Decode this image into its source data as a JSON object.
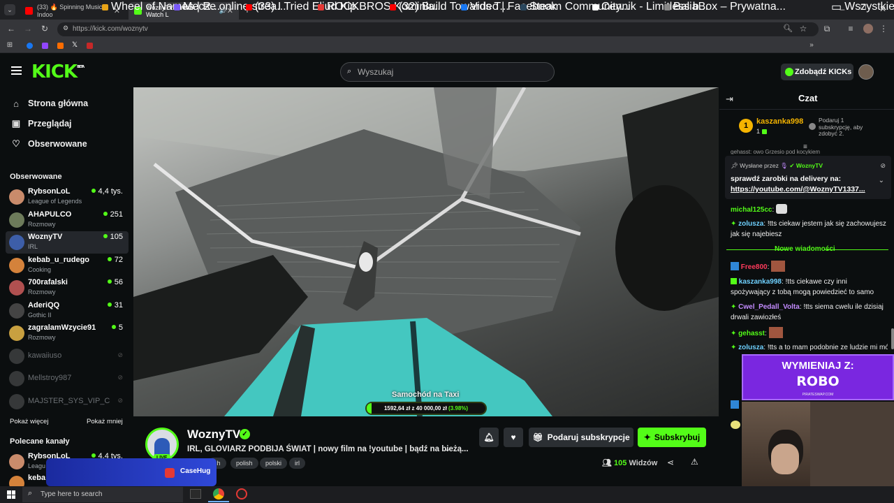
{
  "browser": {
    "tabs": [
      {
        "label": "(33) 🔥 Spinning Music – Indoo",
        "active": false,
        "color": "#ff0000"
      },
      {
        "label": "WoznyTV Stream - Watch L",
        "active": true,
        "color": "#53fc18"
      }
    ],
    "url": "https://kick.com/woznytv",
    "bookmarks": [
      {
        "label": "Wheel of Names | R...",
        "color": "#e8a317"
      },
      {
        "label": "Mecze online strea...",
        "color": "#7a5af8"
      },
      {
        "label": "(33) I Tried Eliud Kip...",
        "color": "#ff0000"
      },
      {
        "label": "ROCKBROS Kominia...",
        "color": "#e53935"
      },
      {
        "label": "(32) Build Towards T...",
        "color": "#ff0000"
      },
      {
        "label": "Video | Facebook",
        "color": "#1877f2"
      },
      {
        "label": "Steam Community...",
        "color": "#2a475e"
      },
      {
        "label": "Cennik - Limitless b...",
        "color": "#ffffff"
      },
      {
        "label": "BaliaBox – Prywatna...",
        "color": "#888888"
      }
    ],
    "all_bookmarks": "Wszystkie zakładki"
  },
  "header": {
    "logo": "KICK",
    "logo_sup": "BETA",
    "search_placeholder": "Wyszukaj",
    "kicks_button": "Zdobądź KICKs"
  },
  "sidebar": {
    "nav": [
      {
        "label": "Strona główna",
        "icon": "home-icon"
      },
      {
        "label": "Przeglądaj",
        "icon": "browse-icon"
      },
      {
        "label": "Obserwowane",
        "icon": "heart-icon"
      }
    ],
    "followed_title": "Obserwowane",
    "followed": [
      {
        "name": "RybsonLoL",
        "category": "League of Legends",
        "viewers": "4,4 tys.",
        "color": "#c98b6b",
        "live": true
      },
      {
        "name": "AHAPULCO",
        "category": "Rozmowy",
        "viewers": "251",
        "color": "#6d7b5a",
        "live": true
      },
      {
        "name": "WoznyTV",
        "category": "IRL",
        "viewers": "105",
        "color": "#3d5ea8",
        "live": true,
        "selected": true
      },
      {
        "name": "kebab_u_rudego",
        "category": "Cooking",
        "viewers": "72",
        "color": "#d4823b",
        "live": true
      },
      {
        "name": "700rafalski",
        "category": "Rozmowy",
        "viewers": "56",
        "color": "#b05050",
        "live": true
      },
      {
        "name": "AderiQQ",
        "category": "Gothic II",
        "viewers": "31",
        "color": "#444444",
        "live": true
      },
      {
        "name": "zagralamWzycie91",
        "category": "Rozmowy",
        "viewers": "5",
        "color": "#c8a040",
        "live": true
      },
      {
        "name": "kawaiiuso",
        "category": "",
        "viewers": "",
        "color": "#777777",
        "live": false
      },
      {
        "name": "Mellstroy987",
        "category": "",
        "viewers": "",
        "color": "#777777",
        "live": false
      },
      {
        "name": "MAJSTER_SYS_VIP_C",
        "category": "",
        "viewers": "",
        "color": "#777777",
        "live": false
      }
    ],
    "show_more": "Pokaż więcej",
    "show_less": "Pokaż mniej",
    "recommended_title": "Polecane kanały",
    "recommended": [
      {
        "name": "RybsonLoL",
        "category": "Leagu",
        "viewers": "4,4 tys.",
        "color": "#c98b6b"
      },
      {
        "name": "keba",
        "category": "",
        "viewers": "",
        "color": "#d4823b"
      }
    ]
  },
  "video": {
    "caption": "Samochód na Taxi",
    "goal": "1592,64 zł z 40 000,00 zł",
    "goal_pct": "(3.98%)",
    "goal_fraction": 0.0398
  },
  "channel": {
    "name": "WoznyTV",
    "live_badge": "LIVE",
    "title": "IRL, GLOVIARZ PODBIJA ŚWIAT | nowy film na !youtube | bądź na bieżą...",
    "tags": [
      "sh",
      "polish",
      "polski",
      "irl"
    ],
    "gift_button": "Podaruj subskrypcje",
    "subscribe_button": "Subskrybuj",
    "viewers": "105",
    "viewers_label": "Widzów"
  },
  "chat": {
    "title": "Czat",
    "leader": {
      "name": "kaszanka998",
      "count": "1",
      "rank": "1",
      "promo": "Podaruj 1 subskrypcję, aby zdobyć 2."
    },
    "partial_top": "gehasst: owo Grzesio pod kocykiem",
    "pinned": {
      "by_label": "Wysłane przez",
      "by_user": "WoznyTV",
      "text": "sprawdź zarobki na delivery na:",
      "link": "https://youtube.com/@WoznyTV1337..."
    },
    "new_messages": "Nowe wiadomości",
    "messages_before": [
      {
        "user": "michal125cc",
        "color": "#53fc18",
        "text": ""
      },
      {
        "user": "zolusza",
        "color": "#6fd1ff",
        "text": "!tts ciekaw jestem jak się zachowujesz jak się najebiesz"
      }
    ],
    "messages_after": [
      {
        "user": "Free800",
        "color": "#ff3b5c",
        "text": ""
      },
      {
        "user": "kaszanka998",
        "color": "#6fd1ff",
        "text": "!tts ciekawe czy inni spożywający z tobą mogą powiedzieć to samo"
      },
      {
        "user": "Cwel_Pedall_Volta",
        "color": "#c38bff",
        "text": "!tts siema cwelu ile dzisiaj drwali zawiozłeś"
      },
      {
        "user": "gehasst",
        "color": "#53fc18",
        "text": ""
      },
      {
        "user": "zolusza",
        "color": "#6fd1ff",
        "text": "!tts a to mam podobnie ze ludzie mi mów"
      }
    ]
  },
  "overlays": {
    "promo_line1": "WYMIENIAJ Z:",
    "promo_line2": "ROBO",
    "promo_small": "PIRATESWAP.COM",
    "ad_brand": "CaseHug"
  },
  "taskbar": {
    "search_placeholder": "Type here to search"
  }
}
